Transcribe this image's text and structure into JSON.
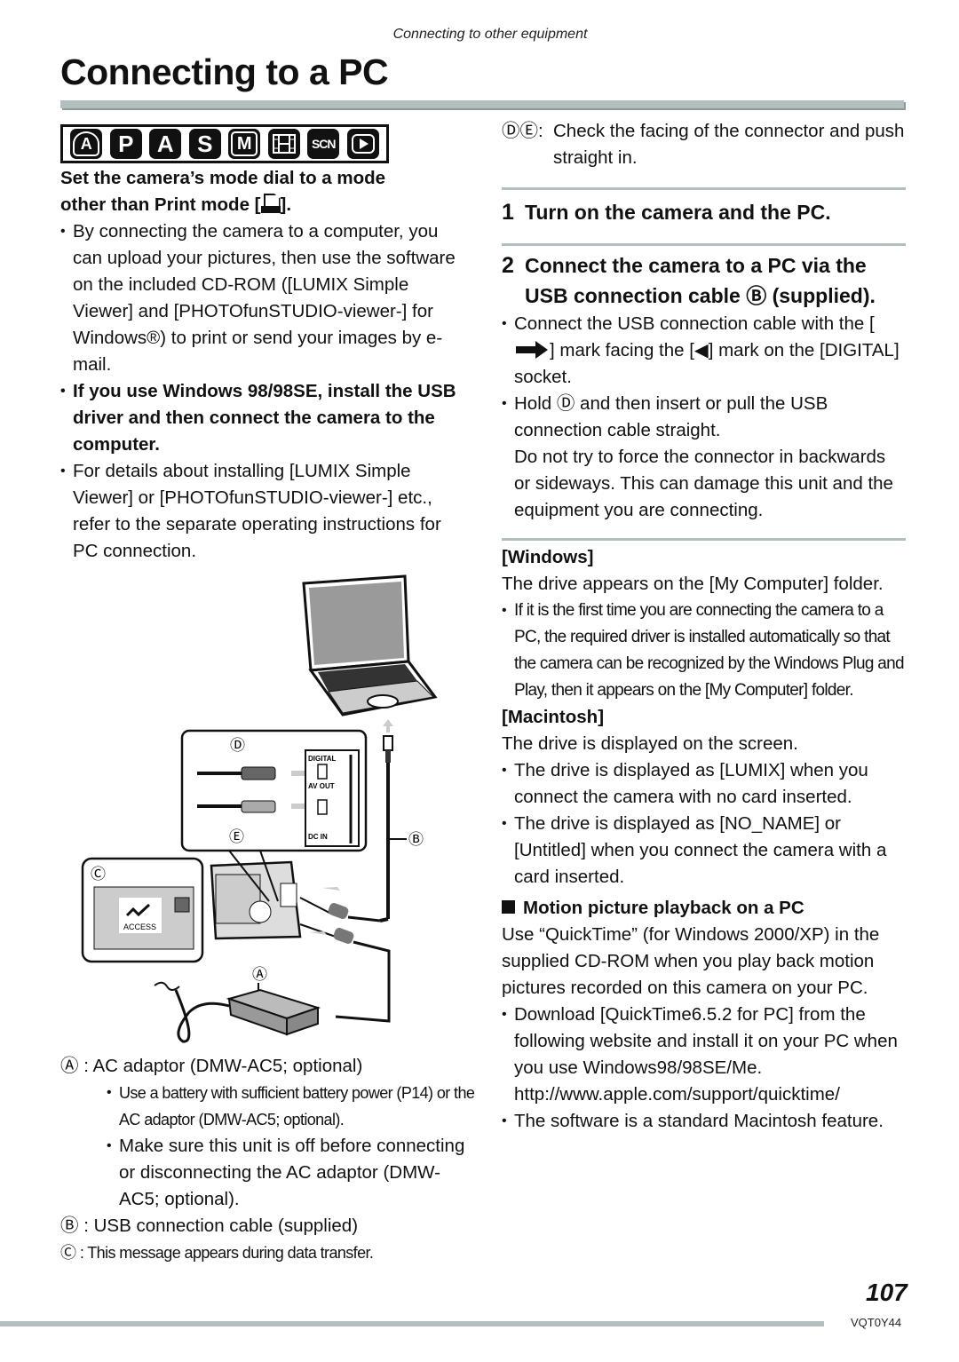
{
  "running_head": "Connecting to other equipment",
  "page_title": "Connecting to a PC",
  "mode_icons": [
    {
      "name": "intelligent-auto",
      "label": "A"
    },
    {
      "name": "program",
      "label": "P"
    },
    {
      "name": "aperture-priority",
      "label": "A"
    },
    {
      "name": "shutter-priority",
      "label": "S"
    },
    {
      "name": "manual",
      "label": "M"
    },
    {
      "name": "motion-picture",
      "label": "film"
    },
    {
      "name": "scene",
      "label": "SCN"
    },
    {
      "name": "playback",
      "label": "▶"
    }
  ],
  "left": {
    "heading_line1": "Set the camera’s mode dial to a mode",
    "heading_line2_pre": "other than Print mode [",
    "heading_line2_post": "].",
    "bullets": [
      {
        "bold": false,
        "text": "By connecting the camera to a computer, you can upload your pictures, then use the software on the included CD-ROM ([LUMIX Simple Viewer] and [PHOTOfunSTUDIO-viewer-] for Windows®) to print or send your images by e-mail."
      },
      {
        "bold": true,
        "text": "If you use Windows 98/98SE, install the USB driver and then connect the camera to the computer."
      },
      {
        "bold": false,
        "text": "For details about installing [LUMIX Simple Viewer] or [PHOTOfunSTUDIO-viewer-] etc., refer to the separate operating instructions for PC connection."
      }
    ]
  },
  "diagram": {
    "callouts": {
      "A": "Ⓐ",
      "B": "Ⓑ",
      "C": "Ⓒ",
      "D": "Ⓓ",
      "E": "Ⓔ"
    },
    "socket_labels": {
      "digital": "DIGITAL",
      "av_out": "AV OUT",
      "dc_in": "DC IN"
    },
    "screen_message": "ACCESS"
  },
  "legend": {
    "a_label": "Ⓐ",
    "a_text": ": AC adaptor (DMW-AC5; optional)",
    "a_bullet1": "Use a battery with sufficient battery power (P14) or the AC adaptor (DMW-AC5; optional).",
    "a_bullet2": "Make sure this unit is off before connecting or disconnecting the AC adaptor (DMW-AC5; optional).",
    "b_label": "Ⓑ",
    "b_text": ": USB connection cable (supplied)",
    "c_label": "Ⓒ",
    "c_text": ": This message appears during data transfer."
  },
  "right": {
    "de_label": "ⒹⒺ:",
    "de_text": "Check the facing of the connector and push straight in.",
    "step1_num": "1",
    "step1_text": "Turn on the camera and the PC.",
    "step2_num": "2",
    "step2_text": "Connect the camera to a PC via the USB connection cable Ⓑ (supplied).",
    "step2_b1_pre": "Connect the USB connection cable with the [",
    "step2_b1_mid": "] mark facing the [◀] mark on the [DIGITAL] socket.",
    "step2_b2": "Hold Ⓓ and then insert or pull the USB connection cable straight.",
    "step2_b2_cont": "Do not try to force the connector in backwards or sideways. This can damage this unit and the equipment you are connecting.",
    "windows_head": "[Windows]",
    "windows_text": "The drive appears on the [My Computer] folder.",
    "windows_bullet": "If it is the first time you are connecting the camera to a PC, the required driver is installed automatically so that the camera can be recognized by the Windows Plug and Play, then it appears on the [My Computer] folder.",
    "mac_head": "[Macintosh]",
    "mac_text": "The drive is displayed on the screen.",
    "mac_bullets": [
      "The drive is displayed as [LUMIX] when you connect the camera with no card inserted.",
      "The drive is displayed as [NO_NAME] or [Untitled] when you connect the camera with a card inserted."
    ],
    "motion_head": "Motion picture playback on a PC",
    "motion_text": "Use “QuickTime” (for Windows 2000/XP) in the supplied CD-ROM when you play back motion pictures recorded on this camera on your PC.",
    "motion_bullet1": "Download [QuickTime6.5.2 for PC] from the following website and install it on your PC when you use Windows98/98SE/Me.",
    "motion_url": "http://www.apple.com/support/quicktime/",
    "motion_bullet2": "The software is a standard Macintosh feature."
  },
  "footer": {
    "page_number": "107",
    "doc_code": "VQT0Y44"
  },
  "colors": {
    "rule_gray": "#b3bfbe",
    "text": "#111111"
  }
}
